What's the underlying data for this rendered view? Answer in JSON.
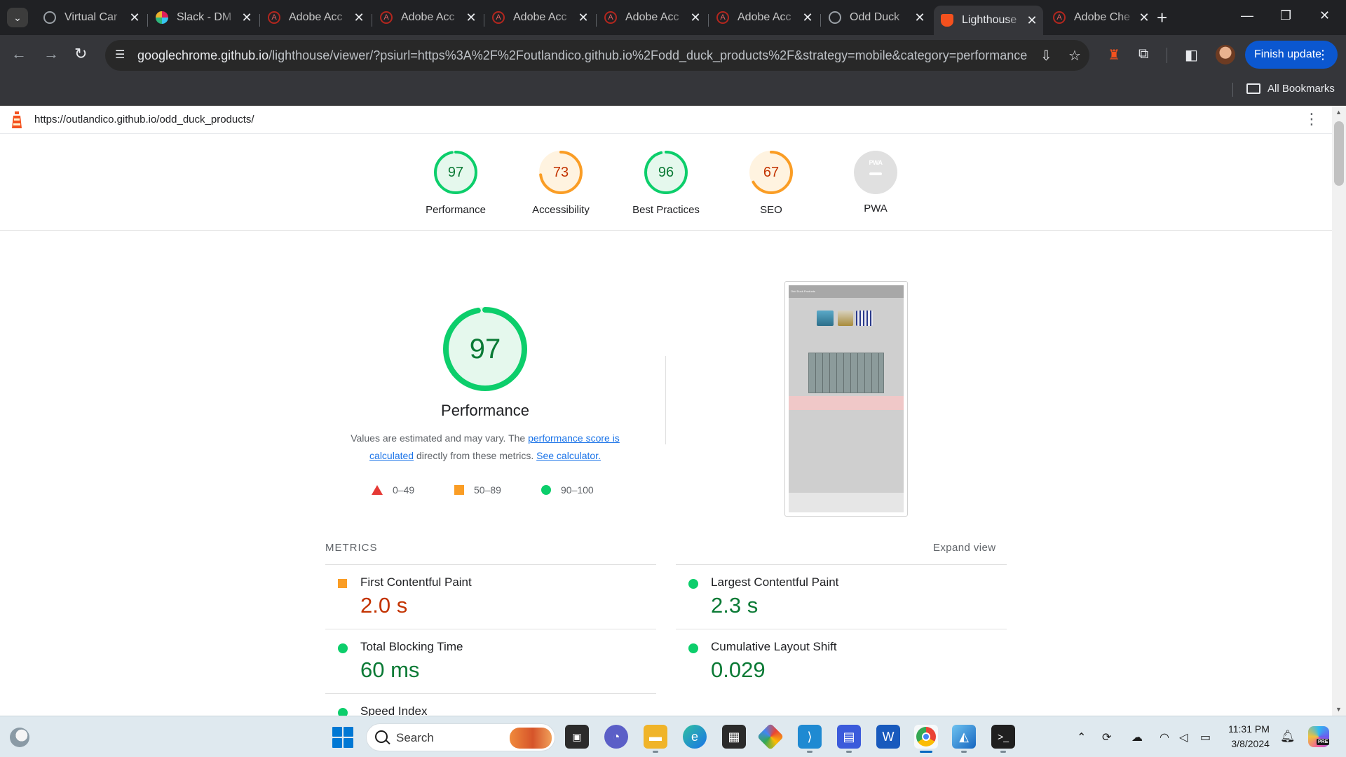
{
  "browser": {
    "tabs": [
      {
        "label": "Virtual Car",
        "favicon": "globe-icon"
      },
      {
        "label": "Slack - DM",
        "favicon": "slack-icon"
      },
      {
        "label": "Adobe Acc",
        "favicon": "adobe-icon"
      },
      {
        "label": "Adobe Acc",
        "favicon": "adobe-icon"
      },
      {
        "label": "Adobe Acc",
        "favicon": "adobe-icon"
      },
      {
        "label": "Adobe Acc",
        "favicon": "adobe-icon"
      },
      {
        "label": "Adobe Acc",
        "favicon": "adobe-icon"
      },
      {
        "label": "Odd Duck",
        "favicon": "globe-icon"
      },
      {
        "label": "Lighthouse",
        "favicon": "lighthouse-icon",
        "active": true
      },
      {
        "label": "Adobe Che",
        "favicon": "adobe-icon"
      }
    ],
    "url_host": "googlechrome.github.io",
    "url_rest": "/lighthouse/viewer/?psiurl=https%3A%2F%2Foutlandico.github.io%2Fodd_duck_products%2F&strategy=mobile&category=performance&...",
    "finish_update_label": "Finish update",
    "bookmarks_label": "All Bookmarks"
  },
  "report": {
    "url": "https://outlandico.github.io/odd_duck_products/",
    "gauges": [
      {
        "score": "97",
        "label": "Performance",
        "value": 0.97,
        "color": "#0cce6b",
        "text_color": "#0a7a35",
        "fill": "#e5f8ed"
      },
      {
        "score": "73",
        "label": "Accessibility",
        "value": 0.73,
        "color": "#fa9d25",
        "text_color": "#c33300",
        "fill": "#fff3e0"
      },
      {
        "score": "96",
        "label": "Best Practices",
        "value": 0.96,
        "color": "#0cce6b",
        "text_color": "#0a7a35",
        "fill": "#e5f8ed"
      },
      {
        "score": "67",
        "label": "SEO",
        "value": 0.67,
        "color": "#fa9d25",
        "text_color": "#c33300",
        "fill": "#fff3e0"
      }
    ],
    "pwa": {
      "badge_text": "PWA",
      "label": "PWA"
    },
    "performance": {
      "score": "97",
      "value": 0.97,
      "title": "Performance",
      "desc_1": "Values are estimated and may vary. The ",
      "desc_link": "performance score is calculated",
      "desc_2": " directly from these metrics. ",
      "desc_link2": "See calculator."
    },
    "legend": [
      {
        "range": "0–49",
        "color": "#e53935"
      },
      {
        "range": "50–89",
        "color": "#fa9d25"
      },
      {
        "range": "90–100",
        "color": "#0cce6b"
      }
    ],
    "screenshot_title": "Odd Duck Products",
    "metrics_label": "METRICS",
    "expand_view": "Expand view",
    "metrics": [
      {
        "name": "First Contentful Paint",
        "value": "2.0 s",
        "status": "average",
        "color": "#c33300"
      },
      {
        "name": "Largest Contentful Paint",
        "value": "2.3 s",
        "status": "pass",
        "color": "#0a7a35"
      },
      {
        "name": "Total Blocking Time",
        "value": "60 ms",
        "status": "pass",
        "color": "#0a7a35"
      },
      {
        "name": "Cumulative Layout Shift",
        "value": "0.029",
        "status": "pass",
        "color": "#0a7a35"
      },
      {
        "name": "Speed Index",
        "value": "",
        "status": "pass",
        "color": "#0a7a35"
      }
    ]
  },
  "taskbar": {
    "search_placeholder": "Search",
    "time": "11:31 PM",
    "date": "3/8/2024",
    "copilot_badge": "PRE"
  }
}
